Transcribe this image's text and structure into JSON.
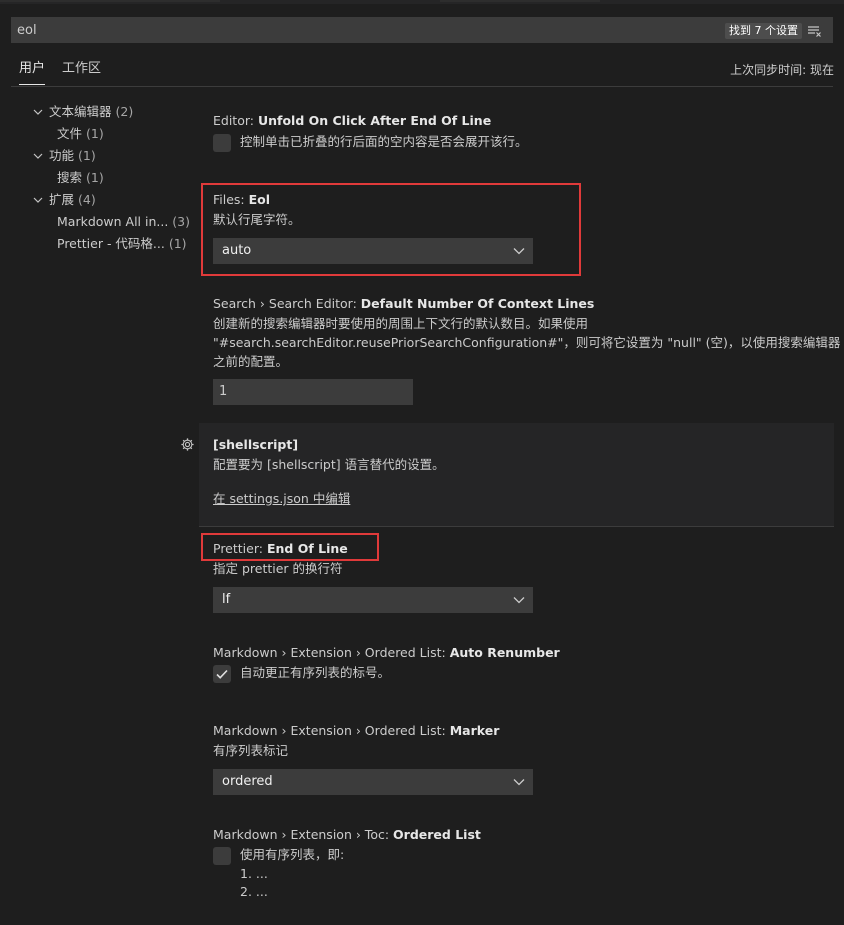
{
  "search": {
    "value": "eol",
    "result_count": "找到 7 个设置"
  },
  "tabs": {
    "user": "用户",
    "workspace": "工作区"
  },
  "sync_status": "上次同步时间: 现在",
  "toc": [
    {
      "label": "文本编辑器",
      "count": "(2)"
    },
    {
      "label": "文件",
      "count": "(1)"
    },
    {
      "label": "功能",
      "count": "(1)"
    },
    {
      "label": "搜索",
      "count": "(1)"
    },
    {
      "label": "扩展",
      "count": "(4)"
    },
    {
      "label": "Markdown All in...",
      "count": "(3)"
    },
    {
      "label": "Prettier - 代码格...",
      "count": "(1)"
    }
  ],
  "settings": {
    "unfold": {
      "category": "Editor: ",
      "key": "Unfold On Click After End Of Line",
      "description": "控制单击已折叠的行后面的空内容是否会展开该行。",
      "checked": false
    },
    "files_eol": {
      "category": "Files: ",
      "key": "Eol",
      "description": "默认行尾字符。",
      "value": "auto"
    },
    "search_context": {
      "category": "Search › Search Editor: ",
      "key": "Default Number Of Context Lines",
      "description_lines": [
        "创建新的搜索编辑器时要使用的周围上下文行的默认数目。如果使用",
        "\"#search.searchEditor.reusePriorSearchConfiguration#\"，则可将它设置为 \"null\" (空)，以使用搜索编辑器",
        "之前的配置。"
      ],
      "value": "1"
    },
    "shellscript": {
      "title": "[shellscript]",
      "description": "配置要为 [shellscript] 语言替代的设置。",
      "link": "在 settings.json 中编辑"
    },
    "prettier_eol": {
      "category": "Prettier: ",
      "key": "End Of Line",
      "description": "指定 prettier 的换行符",
      "value": "lf"
    },
    "md_renumber": {
      "category": "Markdown › Extension › Ordered List: ",
      "key": "Auto Renumber",
      "description": "自动更正有序列表的标号。",
      "checked": true
    },
    "md_marker": {
      "category": "Markdown › Extension › Ordered List: ",
      "key": "Marker",
      "description": "有序列表标记",
      "value": "ordered"
    },
    "md_toc": {
      "category": "Markdown › Extension › Toc: ",
      "key": "Ordered List",
      "description": "使用有序列表，即:",
      "items": [
        "1. ...",
        "2. ..."
      ],
      "checked": false
    }
  },
  "colors": {
    "background": "#1e1e1e",
    "input_background": "#3c3c3c",
    "highlight_border": "#e03a3a",
    "panel_background": "#252526"
  }
}
